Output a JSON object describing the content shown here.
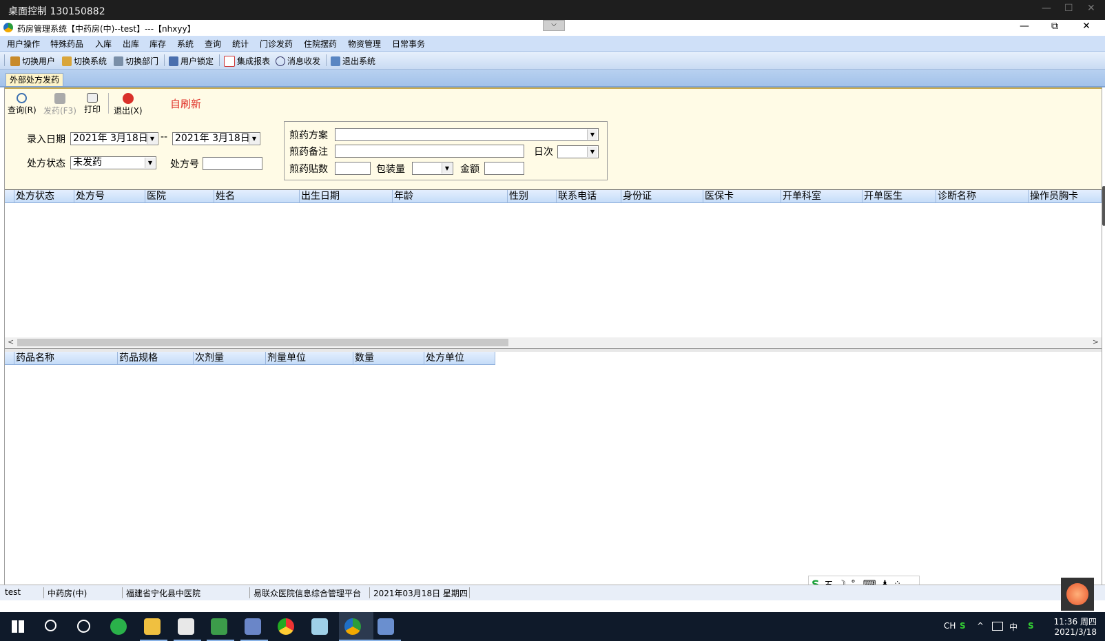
{
  "remote": {
    "title": "桌面控制 130150882",
    "minimize": "—",
    "maximize": "☐",
    "close": "✕"
  },
  "window": {
    "title": "药房管理系统【中药房(中)--test】---【nhxyy】",
    "collapse_glyph": "⌵",
    "minimize": "—",
    "restore": "⧉",
    "close": "✕"
  },
  "menu": [
    "用户操作",
    "特殊药品",
    "入库",
    "出库",
    "库存",
    "系统",
    "查询",
    "统计",
    "门诊发药",
    "住院摆药",
    "物资管理",
    "日常事务"
  ],
  "toolbar": [
    {
      "label": "切换用户",
      "icon": "users-icon",
      "color": "#c88a2a"
    },
    {
      "label": "切换系统",
      "icon": "switch-system-icon",
      "color": "#d9a53a"
    },
    {
      "label": "切换部门",
      "icon": "department-icon",
      "color": "#7a8fa8"
    },
    {
      "label": "用户锁定",
      "icon": "user-lock-icon",
      "color": "#4a6fae"
    },
    {
      "label": "集成报表",
      "icon": "report-icon",
      "color": "#c33"
    },
    {
      "label": "消息收发",
      "icon": "info-icon",
      "color": "#336"
    },
    {
      "label": "退出系统",
      "icon": "exit-icon",
      "color": "#5a86c2"
    }
  ],
  "tab": {
    "label": "外部处方发药"
  },
  "actions": {
    "query": "查询(R)",
    "dispense": "发药(F3)",
    "print": "打印",
    "exit": "退出(X)",
    "auto_refresh": "自刷新"
  },
  "filters": {
    "entry_date_label": "录入日期",
    "date_from": "2021年  3月18日",
    "date_sep": "--",
    "date_to": "2021年  3月18日",
    "status_label": "处方状态",
    "status_value": "未发药",
    "rx_no_label": "处方号",
    "rx_no_value": ""
  },
  "decoction": {
    "plan_label": "煎药方案",
    "plan_value": "",
    "note_label": "煎药备注",
    "note_value": "",
    "daily_label": "日次",
    "daily_value": "",
    "packs_label": "煎药贴数",
    "packs_value": "",
    "package_label": "包装量",
    "package_value": "",
    "amount_label": "金额",
    "amount_value": ""
  },
  "top_grid": {
    "columns": [
      "处方状态",
      "处方号",
      "医院",
      "姓名",
      "出生日期",
      "年龄",
      "性别",
      "联系电话",
      "身份证",
      "医保卡",
      "开单科室",
      "开单医生",
      "诊断名称",
      "操作员胸卡"
    ]
  },
  "bottom_grid": {
    "columns": [
      "药品名称",
      "药品规格",
      "次剂量",
      "剂量单位",
      "数量",
      "处方单位"
    ]
  },
  "status": [
    "test",
    "中药房(中)",
    "福建省宁化县中医院",
    "易联众医院信息综合管理平台",
    "2021年03月18日 星期四"
  ],
  "ime": {
    "logo": "S",
    "mode": "五",
    "moon": "☽",
    "punct": "°,",
    "keyboard": "⌨",
    "user": "♟",
    "grid": "⁘"
  },
  "tray": {
    "lang": "CH",
    "caret": "^",
    "ime_mode": "中",
    "time": "11:36 周四",
    "date": "2021/3/18"
  }
}
